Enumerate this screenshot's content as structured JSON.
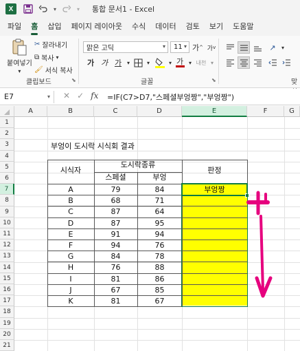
{
  "app": {
    "title": "통합 문서1  -  Excel",
    "logo": "X"
  },
  "menu": {
    "tabs": [
      "파일",
      "홈",
      "삽입",
      "페이지 레이아웃",
      "수식",
      "데이터",
      "검토",
      "보기",
      "도움말"
    ],
    "active": "홈"
  },
  "ribbon": {
    "paste_label": "붙여넣기",
    "cut_label": "잘라내기",
    "copy_label": "복사",
    "format_painter_label": "서식 복사",
    "clipboard_group": "클립보드",
    "font_name": "맑은 고딕",
    "font_size": "11",
    "font_group": "글꼴",
    "align_group_partial": "맞취",
    "grow_font": "가",
    "shrink_font": "가",
    "bold": "가",
    "italic": "가",
    "underline": "가",
    "font_color_letter": "가",
    "phonetic_label": "내천",
    "font_color": "#c00000",
    "fill_color": "#ffff00"
  },
  "formula_bar": {
    "name_box": "E7",
    "formula": "=IF(C7>D7,\"스페셜부엉짱\",\"부엉짱\")",
    "fx": "fx",
    "cancel": "✕",
    "enter": "✓"
  },
  "columns": [
    "A",
    "B",
    "C",
    "D",
    "E",
    "F",
    "G"
  ],
  "rows": [
    "1",
    "2",
    "3",
    "4",
    "5",
    "6",
    "7",
    "8",
    "9",
    "10",
    "11",
    "12",
    "13",
    "14",
    "15",
    "16",
    "17",
    "18",
    "19",
    "20",
    "21"
  ],
  "sheet": {
    "title": "부엉이 도시락 시식회 결과",
    "header_taster": "시식자",
    "header_lunchbox": "도시락종류",
    "header_special": "스페셜",
    "header_owl": "부엉",
    "header_verdict": "판정",
    "rows": [
      {
        "name": "A",
        "special": "79",
        "owl": "84",
        "verdict": "부엉짱"
      },
      {
        "name": "B",
        "special": "68",
        "owl": "71",
        "verdict": ""
      },
      {
        "name": "C",
        "special": "87",
        "owl": "64",
        "verdict": ""
      },
      {
        "name": "D",
        "special": "87",
        "owl": "95",
        "verdict": ""
      },
      {
        "name": "E",
        "special": "91",
        "owl": "94",
        "verdict": ""
      },
      {
        "name": "F",
        "special": "94",
        "owl": "76",
        "verdict": ""
      },
      {
        "name": "G",
        "special": "84",
        "owl": "78",
        "verdict": ""
      },
      {
        "name": "H",
        "special": "76",
        "owl": "88",
        "verdict": ""
      },
      {
        "name": "I",
        "special": "81",
        "owl": "86",
        "verdict": ""
      },
      {
        "name": "J",
        "special": "67",
        "owl": "85",
        "verdict": ""
      },
      {
        "name": "K",
        "special": "81",
        "owl": "67",
        "verdict": ""
      }
    ]
  },
  "active_cell": "E7",
  "annotation_color": "#e6007e"
}
